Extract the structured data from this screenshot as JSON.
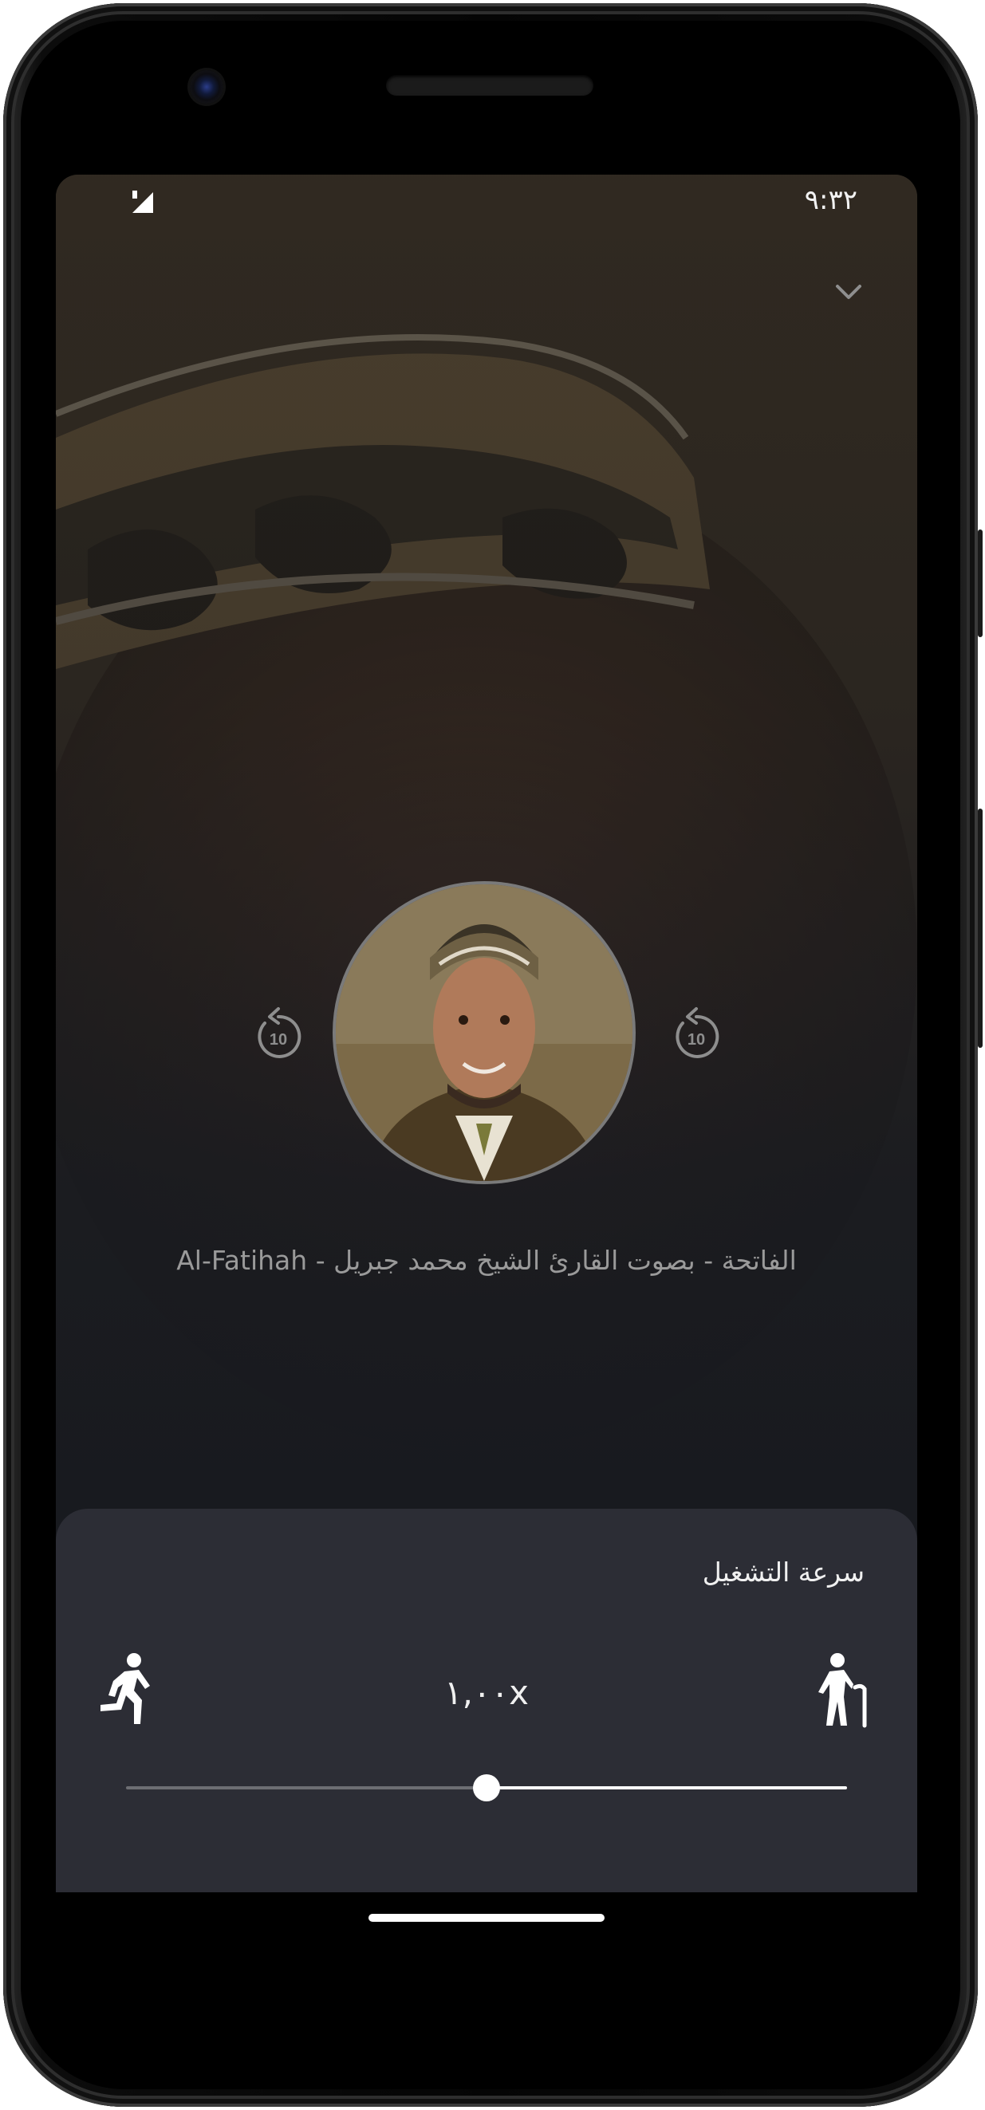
{
  "status_bar": {
    "time": "٩:٣٢",
    "icons": [
      "signal-icon"
    ]
  },
  "header": {
    "collapse_icon": "chevron-down-icon"
  },
  "player": {
    "track_title": "الفاتحة - بصوت القارئ الشيخ محمد جبريل - Al-Fatihah",
    "skip_back_seconds": "10",
    "skip_forward_seconds": "10",
    "skip_back_icon": "rewind-10-icon",
    "skip_forward_icon": "forward-10-icon",
    "artwork_icon": "reciter-portrait"
  },
  "speed_sheet": {
    "title": "سرعة التشغيل",
    "value": "١,٠٠x",
    "fast_icon": "running-person-icon",
    "slow_icon": "elderly-person-icon",
    "slider_fraction": 0.5
  },
  "colors": {
    "sheet_background": "#2c2d35",
    "screen_background": "#181a1f",
    "slider_active": "#ffffff",
    "slider_inactive": "#6d6e73"
  }
}
